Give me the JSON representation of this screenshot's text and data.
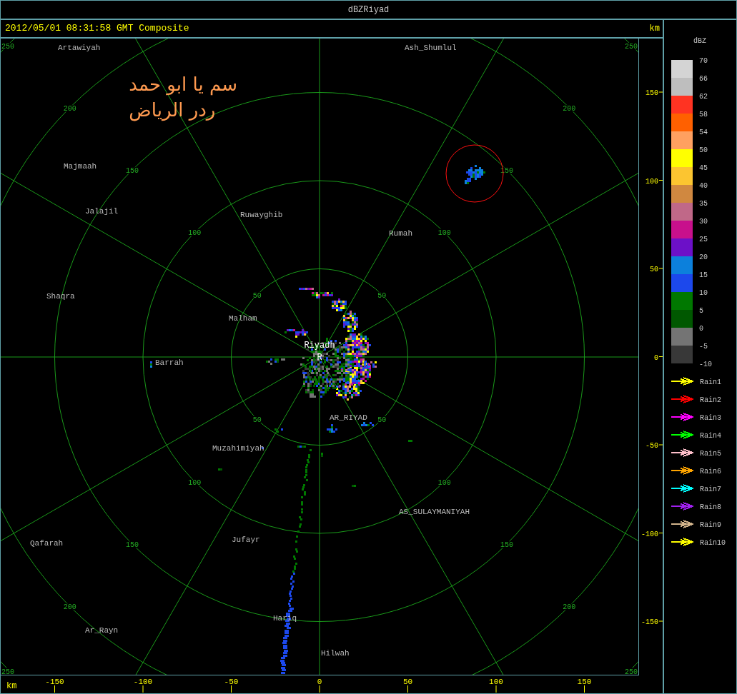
{
  "window": {
    "title": "dBZRiyad"
  },
  "header": {
    "timestamp": "2012/05/01 08:31:58 GMT Composite",
    "unit": "km"
  },
  "overlay_text": [
    "سم يا ابو حمد",
    "ردر الرياض"
  ],
  "radar_map": {
    "rings": [
      {
        "labels": [
          "50",
          "50",
          "50",
          "50"
        ]
      },
      {
        "labels": [
          "100",
          "100",
          "100",
          "100"
        ]
      },
      {
        "labels": [
          "150",
          "150",
          "150",
          "150"
        ]
      },
      {
        "labels": [
          "200",
          "200",
          "200",
          "200"
        ]
      },
      {
        "labels": [
          "250",
          "250",
          "250",
          "250"
        ]
      }
    ],
    "places": [
      "Artawiyah",
      "Ash_Shumlul",
      "Majmaah",
      "Jalajil",
      "Ruwayghib",
      "Rumah",
      "Shaqra",
      "Malham",
      "Barrah",
      "AR_RIYAD",
      "Muzahimiyah",
      "AS_SULAYMANIYAH",
      "Qafarah",
      "Jufayr",
      "Hariq",
      "Ar_Rayn",
      "Hilwah"
    ],
    "site": {
      "name": "Riyadh",
      "marker": "R"
    }
  },
  "x_axis": {
    "unit": "km",
    "ticks": [
      "-150",
      "-100",
      "-50",
      "0",
      "50",
      "100",
      "150"
    ]
  },
  "y_axis": {
    "ticks": [
      "150",
      "100",
      "50",
      "0",
      "-50",
      "-100",
      "-150"
    ]
  },
  "legend": {
    "title": "dBZ",
    "labels": [
      "70",
      "66",
      "62",
      "58",
      "54",
      "50",
      "45",
      "40",
      "35",
      "30",
      "25",
      "20",
      "15",
      "10",
      "5",
      "0",
      "-5",
      "-10"
    ],
    "bands": [
      {
        "color": "#d4d4d4"
      },
      {
        "color": "#bebebe"
      },
      {
        "color": "#ff3322"
      },
      {
        "color": "#ff6000"
      },
      {
        "color": "#ffa060"
      },
      {
        "color": "#ffff00"
      },
      {
        "color": "#fcc530"
      },
      {
        "color": "#d08840"
      },
      {
        "color": "#c06888"
      },
      {
        "color": "#c8108c"
      },
      {
        "color": "#6c10c8"
      },
      {
        "color": "#0c80dc"
      },
      {
        "color": "#1c48ec"
      },
      {
        "color": "#007800"
      },
      {
        "color": "#005800"
      },
      {
        "color": "#747474"
      },
      {
        "color": "#383838"
      }
    ],
    "tracks": [
      {
        "label": "Rain1",
        "color": "#ffff00"
      },
      {
        "label": "Rain2",
        "color": "#ff0000"
      },
      {
        "label": "Rain3",
        "color": "#ff00ff"
      },
      {
        "label": "Rain4",
        "color": "#00ff00"
      },
      {
        "label": "Rain5",
        "color": "#ffc0cb"
      },
      {
        "label": "Rain6",
        "color": "#ffa500"
      },
      {
        "label": "Rain7",
        "color": "#00ffff"
      },
      {
        "label": "Rain8",
        "color": "#a020f0"
      },
      {
        "label": "Rain9",
        "color": "#d2b48c"
      },
      {
        "label": "Rain10",
        "color": "#ffff00"
      }
    ]
  }
}
